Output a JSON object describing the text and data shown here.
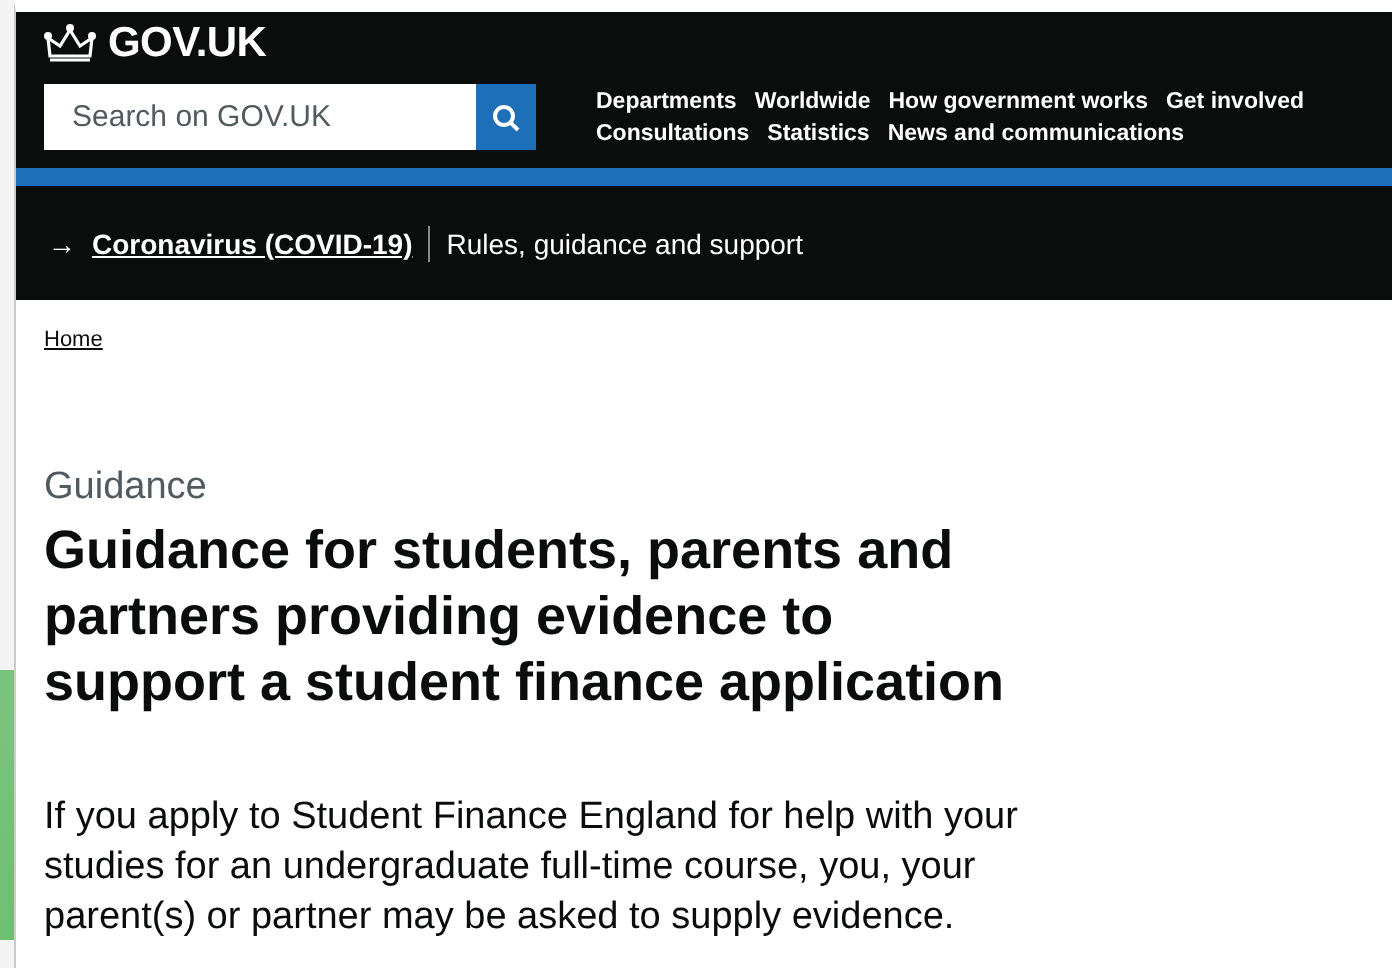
{
  "header": {
    "logo": "GOV.UK",
    "search": {
      "placeholder": "Search on GOV.UK"
    },
    "nav": [
      [
        "Departments",
        "Worldwide",
        "How government works",
        "Get involved"
      ],
      [
        "Consultations",
        "Statistics",
        "News and communications"
      ]
    ]
  },
  "banner": {
    "arrow": "→",
    "link": "Coronavirus (COVID-19)",
    "text": "Rules, guidance and support"
  },
  "breadcrumbs": [
    "Home"
  ],
  "caption": "Guidance",
  "title": "Guidance for students, parents and partners providing evidence to support a student finance application",
  "intro": "If you apply to Student Finance England for help with your studies for an undergraduate full-time course, you, your parent(s) or partner may be asked to supply evidence."
}
